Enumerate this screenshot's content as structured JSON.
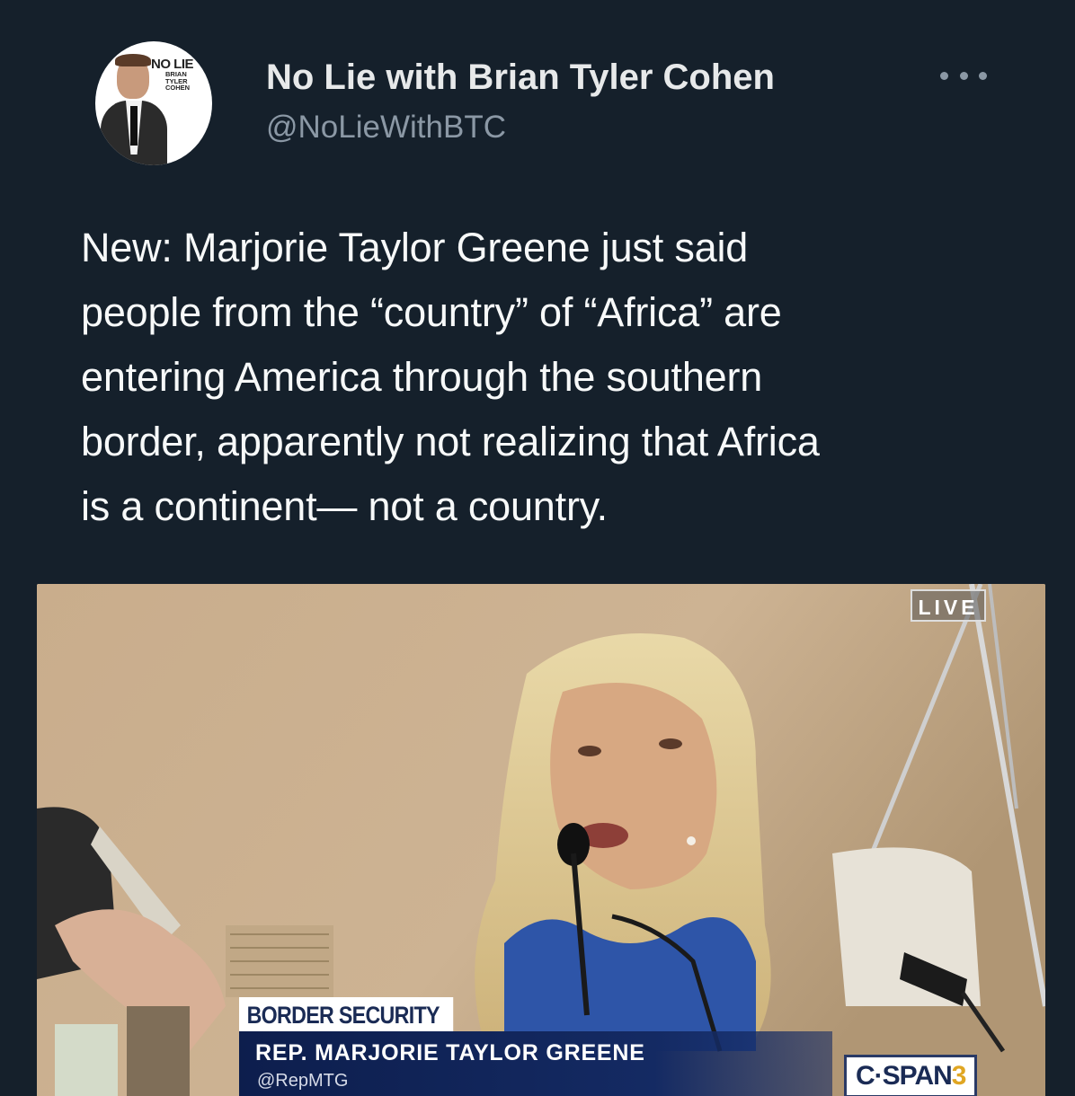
{
  "tweet": {
    "display_name": "No Lie with Brian Tyler Cohen",
    "handle": "@NoLieWithBTC",
    "more_icon": "more-horizontal-icon",
    "avatar_logo": {
      "title": "NO LIE",
      "subtitle_1": "BRIAN",
      "subtitle_2": "TYLER",
      "subtitle_3": "COHEN"
    },
    "text_lines": [
      "New: Marjorie Taylor Greene just said",
      "people from the “country” of “Africa” are",
      "entering America through the southern",
      "border, apparently not realizing that Africa",
      "is a continent— not a country."
    ]
  },
  "media": {
    "live_label": "LIVE",
    "chyron_tag": "BORDER SECURITY",
    "chyron_name": "REP. MARJORIE TAYLOR GREENE",
    "chyron_handle": "@RepMTG",
    "network_name": "C·SPAN",
    "network_number": "3"
  },
  "colors": {
    "background": "#15202b",
    "text_primary": "#e7e9ea",
    "text_secondary": "#8b98a5",
    "chyron_navy": "#142a63",
    "cspan_accent": "#e0a623"
  }
}
